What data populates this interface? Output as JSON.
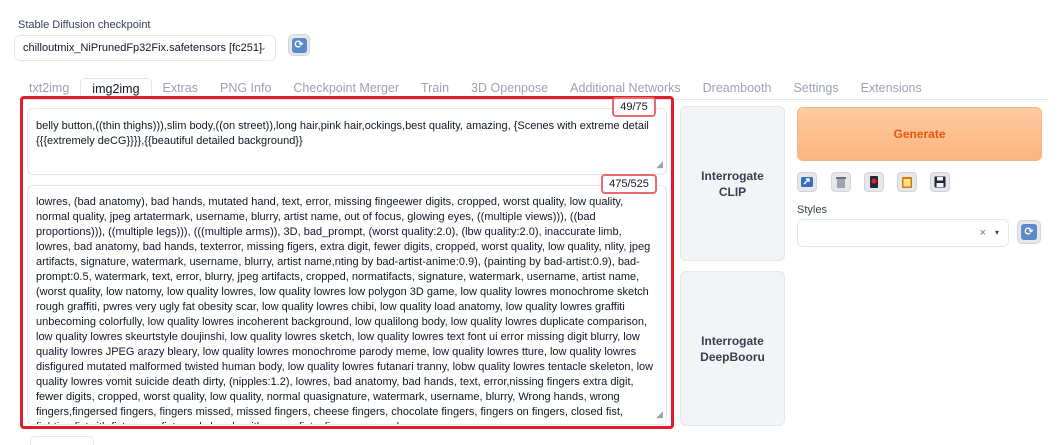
{
  "checkpoint": {
    "label": "Stable Diffusion checkpoint",
    "value": "chilloutmix_NiPrunedFp32Fix.safetensors [fc251]",
    "refresh_icon": "refresh-icon"
  },
  "tabs": [
    {
      "label": "txt2img",
      "active": false
    },
    {
      "label": "img2img",
      "active": true
    },
    {
      "label": "Extras",
      "active": false
    },
    {
      "label": "PNG Info",
      "active": false
    },
    {
      "label": "Checkpoint Merger",
      "active": false
    },
    {
      "label": "Train",
      "active": false
    },
    {
      "label": "3D Openpose",
      "active": false
    },
    {
      "label": "Additional Networks",
      "active": false
    },
    {
      "label": "Dreambooth",
      "active": false
    },
    {
      "label": "Settings",
      "active": false
    },
    {
      "label": "Extensions",
      "active": false
    }
  ],
  "prompt": {
    "counter": "49/75",
    "text": "belly button,((thin thighs))),slim body,((on street)),long hair,pink hair,ockings,best quality, amazing, {Scenes with extreme detail {{{extremely deCG}}}},{{beautiful detailed background}}"
  },
  "negative_prompt": {
    "counter": "475/525",
    "text": "lowres, (bad anatomy), bad hands, mutated hand, text, error, missing fingeewer digits, cropped, worst quality, low quality, normal quality, jpeg artatermark, username, blurry, artist name, out of focus, glowing eyes, ((multiple views))), ((bad proportions))), ((multiple legs))), (((multiple arms)), 3D, bad_prompt, (worst quality:2.0), (lbw quality:2.0), inaccurate limb, lowres, bad anatomy, bad hands, texterror, missing figers, extra digit, fewer digits, cropped, worst quality, low quality, nlity, jpeg artifacts, signature, watermark, username, blurry, artist name,nting by bad-artist-anime:0.9), (painting by bad-artist:0.9), bad-prompt:0.5, watermark, text, error, blurry, jpeg artifacts, cropped, normatifacts, signature, watermark, username, artist name, (worst quality, low natomy, low quality lowres, low quality lowres low polygon 3D game, low quality lowres monochrome sketch rough graffiti, pwres very ugly fat obesity scar, low quality lowres chibi, low quality load anatomy, low quality lowres graffiti unbecoming colorfully, low quality lowres incoherent background, low qualilong body, low quality lowres duplicate comparison, low quality lowres skeurtstyle doujinshi, low quality lowres sketch, low quality lowres text font ui error missing digit blurry, low quality lowres JPEG arazy bleary, low quality lowres monochrome parody meme, low quality lowres tture, low quality lowres disfigured mutated malformed twisted human body, low quality lowres futanari tranny, lobw quality lowres tentacle skeleton, low quality lowres vomit suicide death dirty, (nipples:1.2), lowres, bad anatomy, bad hands, text, error,nissing fingers extra digit, fewer digits, cropped, worst quality, low quality, normal quasignature, watermark, username, blurry, Wrong hands, wrong fingers,fingersed fingers, fingers missed, missed fingers, cheese fingers, chocolate fingers, fingers on fingers, closed fist, fighting fistwith fist, many fists, only hands with wrong fists, fingers crossed"
  },
  "interrogate": {
    "clip": "Interrogate CLIP",
    "deepbooru": "Interrogate DeepBooru"
  },
  "generate": {
    "label": "Generate",
    "color": "#ea580c"
  },
  "tools": [
    "open-folder-icon",
    "trash-icon",
    "red-card-icon",
    "clipboard-icon",
    "floppy-disk-icon"
  ],
  "styles": {
    "label": "Styles",
    "clear_glyph": "×",
    "dropdown_glyph": "▾"
  },
  "highlight_color": "#e11d2a"
}
